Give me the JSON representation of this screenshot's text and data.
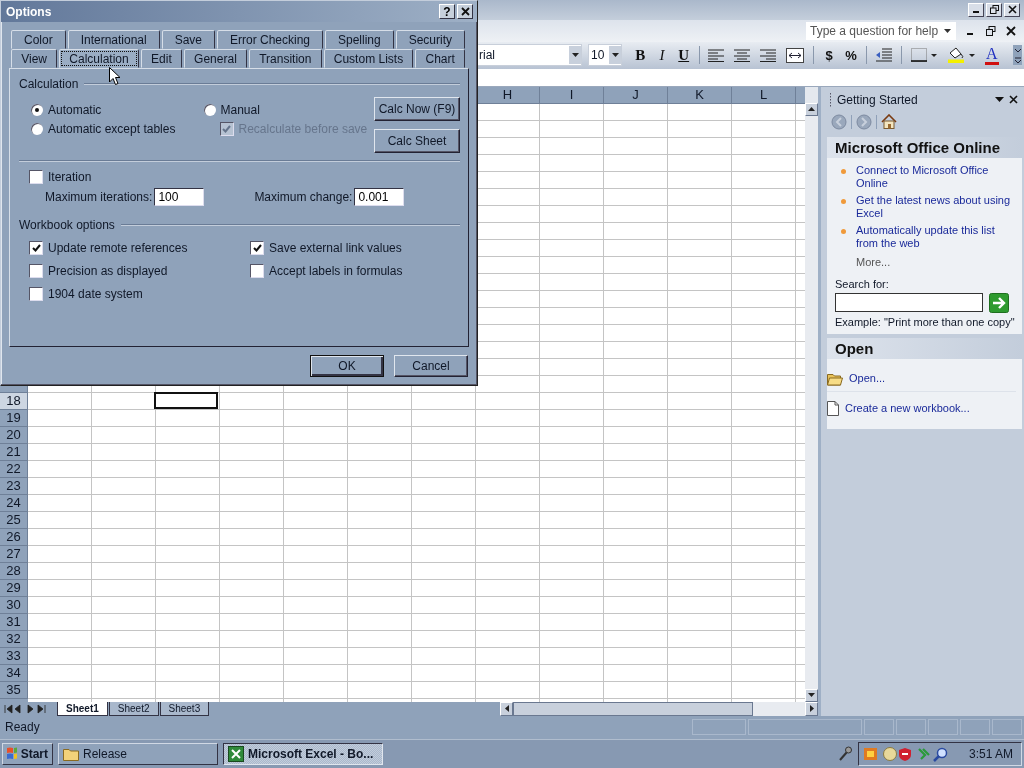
{
  "excel": {
    "help_placeholder": "Type a question for help",
    "font_name": "rial",
    "font_size": "10",
    "toolbar_buttons": [
      {
        "kind": "bold",
        "label": "B"
      },
      {
        "kind": "italic",
        "label": "I"
      },
      {
        "kind": "underline",
        "label": "U"
      },
      {
        "kind": "sep"
      },
      {
        "kind": "align-left"
      },
      {
        "kind": "align-center"
      },
      {
        "kind": "align-right"
      },
      {
        "kind": "merge"
      },
      {
        "kind": "sep"
      },
      {
        "kind": "currency",
        "label": "$"
      },
      {
        "kind": "percent",
        "label": "%"
      },
      {
        "kind": "sep"
      },
      {
        "kind": "indent"
      },
      {
        "kind": "sep"
      },
      {
        "kind": "borders"
      },
      {
        "kind": "fill"
      },
      {
        "kind": "font-color",
        "label": "A"
      }
    ],
    "columns": [
      "H",
      "I",
      "J",
      "K",
      "L"
    ],
    "rows": [
      {
        "label": "18",
        "selected": true
      },
      {
        "label": "19",
        "selected": false
      },
      {
        "label": "20",
        "selected": false
      },
      {
        "label": "21",
        "selected": false
      },
      {
        "label": "22",
        "selected": false
      },
      {
        "label": "23",
        "selected": false
      },
      {
        "label": "24",
        "selected": false
      },
      {
        "label": "25",
        "selected": false
      },
      {
        "label": "26",
        "selected": false
      },
      {
        "label": "27",
        "selected": false
      },
      {
        "label": "28",
        "selected": false
      },
      {
        "label": "29",
        "selected": false
      },
      {
        "label": "30",
        "selected": false
      },
      {
        "label": "31",
        "selected": false
      },
      {
        "label": "32",
        "selected": false
      },
      {
        "label": "33",
        "selected": false
      },
      {
        "label": "34",
        "selected": false
      },
      {
        "label": "35",
        "selected": false
      }
    ],
    "sheet_tabs": [
      {
        "label": "Sheet1",
        "selected": true
      },
      {
        "label": "Sheet2",
        "selected": false
      },
      {
        "label": "Sheet3",
        "selected": false
      }
    ],
    "status": "Ready"
  },
  "task_pane": {
    "title": "Getting Started",
    "online": {
      "title": "Microsoft Office Online",
      "links": [
        "Connect to Microsoft Office Online",
        "Get the latest news about using Excel",
        "Automatically update this list from the web"
      ],
      "more": "More...",
      "search_label": "Search for:",
      "example": "Example:  \"Print more than one copy\""
    },
    "open": {
      "title": "Open",
      "items": [
        {
          "kind": "folder",
          "label": "Open..."
        },
        {
          "kind": "document",
          "label": "Create a new workbook..."
        }
      ]
    }
  },
  "taskbar": {
    "start": "Start",
    "tasks": [
      {
        "kind": "folder",
        "label": "Release",
        "selected": false
      },
      {
        "kind": "excel",
        "label": "Microsoft Excel - Bo...",
        "selected": true
      }
    ],
    "clock": "3:51 AM"
  },
  "dialog": {
    "title": "Options",
    "help_button": "?",
    "tab_rows": [
      {
        "tabs": [
          {
            "label": "Color",
            "selected": false
          },
          {
            "label": "International",
            "selected": false
          },
          {
            "label": "Save",
            "selected": false
          },
          {
            "label": "Error Checking",
            "selected": false
          },
          {
            "label": "Spelling",
            "selected": false
          },
          {
            "label": "Security",
            "selected": false
          }
        ]
      },
      {
        "tabs": [
          {
            "label": "View",
            "selected": false
          },
          {
            "label": "Calculation",
            "selected": true
          },
          {
            "label": "Edit",
            "selected": false
          },
          {
            "label": "General",
            "selected": false
          },
          {
            "label": "Transition",
            "selected": false
          },
          {
            "label": "Custom Lists",
            "selected": false
          },
          {
            "label": "Chart",
            "selected": false
          }
        ]
      }
    ],
    "calculation": {
      "title": "Calculation",
      "modes": [
        {
          "label": "Automatic",
          "selected": true
        },
        {
          "label": "Automatic except tables",
          "selected": false
        },
        {
          "label": "Manual",
          "selected": false
        }
      ],
      "recalculate": {
        "label": "Recalculate before save",
        "checked": true,
        "disabled": true
      },
      "buttons": [
        "Calc Now (F9)",
        "Calc Sheet"
      ],
      "iteration": {
        "label": "Iteration",
        "checked": false
      },
      "max_iterations": {
        "label": "Maximum iterations:",
        "value": "100"
      },
      "max_change": {
        "label": "Maximum change:",
        "value": "0.001"
      }
    },
    "workbook": {
      "title": "Workbook options",
      "options": [
        {
          "label": "Update remote references",
          "checked": true
        },
        {
          "label": "Save external link values",
          "checked": true
        },
        {
          "label": "Precision as displayed",
          "checked": false
        },
        {
          "label": "Accept labels in formulas",
          "checked": false
        },
        {
          "label": "1904 date system",
          "checked": false
        }
      ]
    },
    "buttons": [
      "OK",
      "Cancel"
    ]
  }
}
